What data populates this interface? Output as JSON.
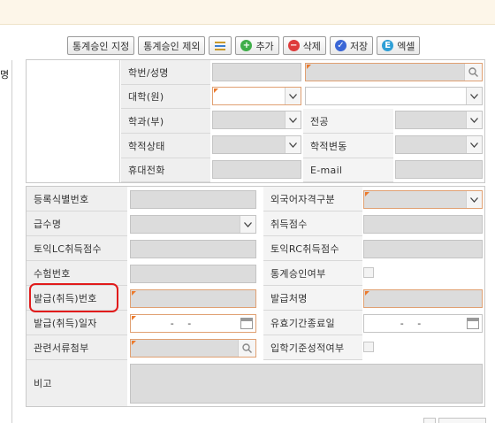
{
  "toolbar": {
    "approve_assign": "통계승인 지정",
    "approve_exclude": "통계승인 제외",
    "add": "추가",
    "delete": "삭제",
    "save": "저장",
    "excel": "엑셀"
  },
  "left_tab": {
    "label": "명"
  },
  "student": {
    "id_name": "학번/성명",
    "college": "대학(원)",
    "department": "학과(부)",
    "major": "전공",
    "status": "학적상태",
    "status_change": "학적변동",
    "mobile": "휴대전화",
    "email": "E-mail"
  },
  "cert": {
    "reg_id": "등록식별번호",
    "lang_cert_type": "외국어자격구분",
    "grade_name": "급수명",
    "score": "취득점수",
    "toeic_lc": "토익LC취득점수",
    "toeic_rc": "토익RC취득점수",
    "exam_no": "수험번호",
    "stat_approved": "통계승인여부",
    "issue_no": "발급(취득)번호",
    "issuer": "발급처명",
    "issue_date": "발급(취득)일자",
    "expiry_date": "유효기간종료일",
    "attachment": "관련서류첨부",
    "admission_grade": "입학기준성적여부",
    "remarks": "비고",
    "date_placeholder": "- -"
  }
}
